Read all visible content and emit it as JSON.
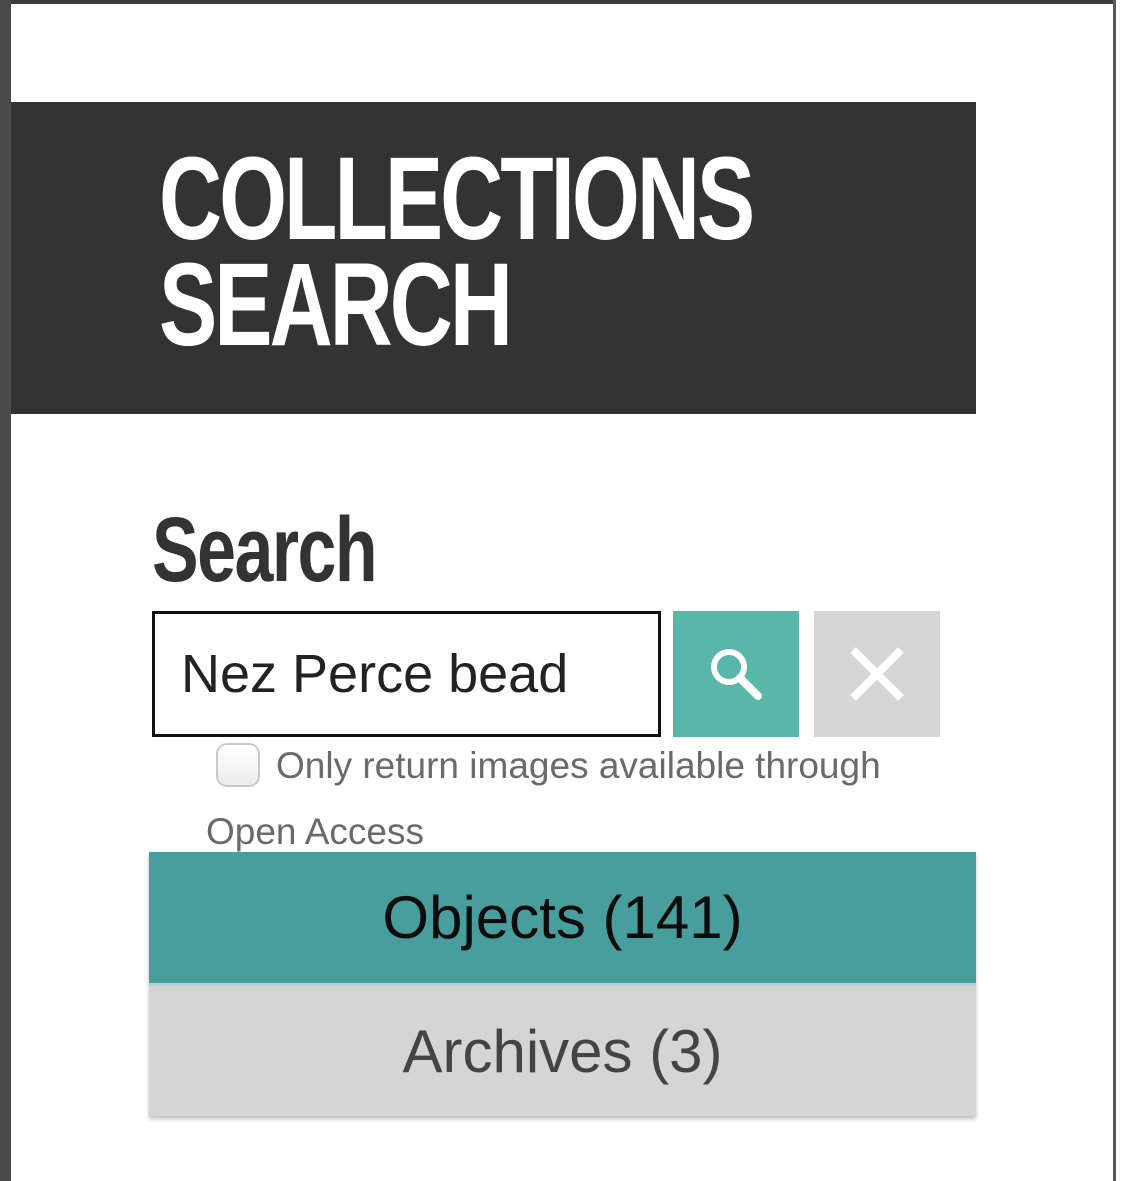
{
  "header": {
    "title_line1": "COLLECTIONS",
    "title_line2": "SEARCH"
  },
  "search": {
    "heading": "Search",
    "query": "Nez Perce bead",
    "search_button_icon": "search-icon",
    "clear_button_icon": "close-icon"
  },
  "filter": {
    "checked": false,
    "label_line1": "Only return images available through",
    "label_line2": "Open Access"
  },
  "tabs": [
    {
      "label": "Objects (141)",
      "active": true
    },
    {
      "label": "Archives (3)",
      "active": false
    }
  ],
  "colors": {
    "banner": "#333333",
    "search_button": "#58b7a9",
    "active_tab": "#489d9d",
    "inactive": "#d5d5d5"
  }
}
